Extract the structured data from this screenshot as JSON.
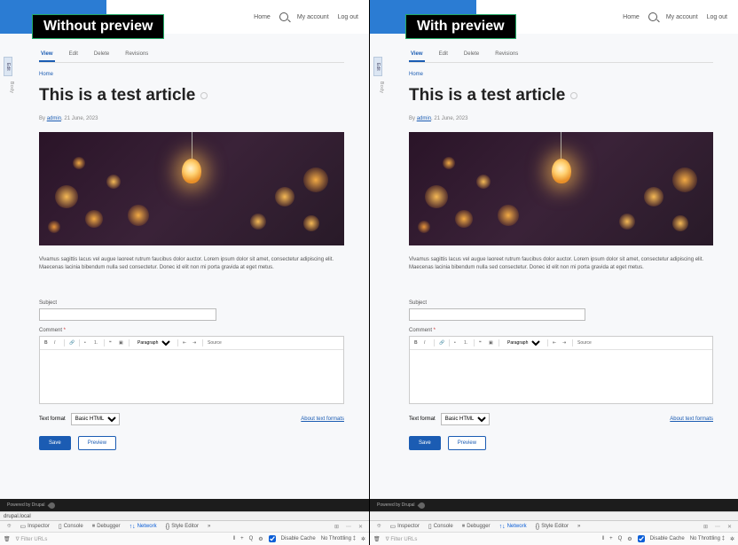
{
  "labels": {
    "left": "Without preview",
    "right": "With preview"
  },
  "nav": {
    "home": "Home",
    "my_account": "My account",
    "log_out": "Log out"
  },
  "side_tab": "Edit",
  "side_txt": "Body",
  "tabs": {
    "view": "View",
    "edit": "Edit",
    "delete": "Delete",
    "revisions": "Revisions"
  },
  "breadcrumb": "Home",
  "title": "This is a test article",
  "byline": {
    "by": "By",
    "author": "admin",
    "date": "21 June, 2023"
  },
  "body": "Vivamus sagittis lacus vel augue laoreet rutrum faucibus dolor auctor. Lorem ipsum dolor sit amet, consectetur adipiscing elit. Maecenas lacinia bibendum nulla sed consectetur. Donec id elit non mi porta gravida at eget metus.",
  "comment": {
    "subject_label": "Subject",
    "comment_label": "Comment",
    "format_paragraph": "Paragraph",
    "source_btn": "Source",
    "text_format_label": "Text format",
    "text_format_value": "Basic HTML",
    "about_link": "About text formats",
    "save": "Save",
    "preview": "Preview"
  },
  "footer": {
    "powered": "Powered by Drupal"
  },
  "devtools": {
    "address": "drupal.local",
    "tabs": {
      "inspector": "Inspector",
      "console": "Console",
      "debugger": "Debugger",
      "network": "Network",
      "style": "Style Editor"
    },
    "filter_placeholder": "Filter URLs",
    "disable_cache": "Disable Cache",
    "throttling": "No Throttling"
  }
}
